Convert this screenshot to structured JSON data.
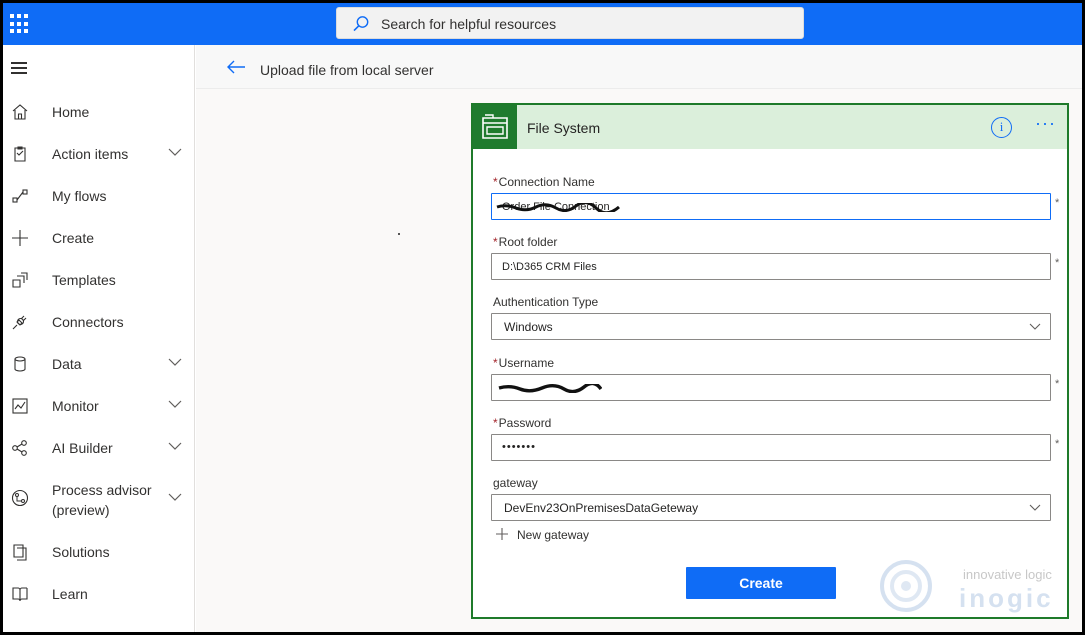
{
  "search": {
    "placeholder": "Search for helpful resources"
  },
  "nav": {
    "items": [
      {
        "label": "Home",
        "icon": "home-icon",
        "expandable": false
      },
      {
        "label": "Action items",
        "icon": "clipboard-icon",
        "expandable": true
      },
      {
        "label": "My flows",
        "icon": "flow-icon",
        "expandable": false
      },
      {
        "label": "Create",
        "icon": "plus-icon",
        "expandable": false
      },
      {
        "label": "Templates",
        "icon": "templates-icon",
        "expandable": false
      },
      {
        "label": "Connectors",
        "icon": "plug-icon",
        "expandable": false
      },
      {
        "label": "Data",
        "icon": "database-icon",
        "expandable": true
      },
      {
        "label": "Monitor",
        "icon": "chart-icon",
        "expandable": true
      },
      {
        "label": "AI Builder",
        "icon": "ai-icon",
        "expandable": true
      },
      {
        "label": "Process advisor",
        "label2": "(preview)",
        "icon": "process-icon",
        "expandable": true
      },
      {
        "label": "Solutions",
        "icon": "solutions-icon",
        "expandable": false
      },
      {
        "label": "Learn",
        "icon": "book-icon",
        "expandable": false
      }
    ]
  },
  "breadcrumb": {
    "title": "Upload file from local server"
  },
  "card": {
    "title": "File System",
    "info_glyph": "i",
    "more_glyph": "···",
    "fields": {
      "connection_name": {
        "label": "Connection Name",
        "required": true,
        "value": "Order File Connection"
      },
      "root_folder": {
        "label": "Root folder",
        "required": true,
        "value": "D:\\D365 CRM Files"
      },
      "auth_type": {
        "label": "Authentication Type",
        "required": false,
        "value": "Windows"
      },
      "username": {
        "label": "Username",
        "required": true,
        "value": ""
      },
      "password": {
        "label": "Password",
        "required": true,
        "value": "•••••••"
      },
      "gateway": {
        "label": "gateway",
        "required": false,
        "value": "DevEnv23OnPremisesDataGeteway"
      }
    },
    "new_gateway": "New gateway",
    "create_button": "Create",
    "required_mark": "*"
  },
  "watermark": {
    "tagline": "innovative logic",
    "brand": "inogic"
  },
  "colors": {
    "topbar": "#0f6cf6",
    "accent": "#0f6cf6",
    "card_border": "#1e7a2a",
    "card_header": "#dbefdb",
    "required": "#a4262c"
  }
}
